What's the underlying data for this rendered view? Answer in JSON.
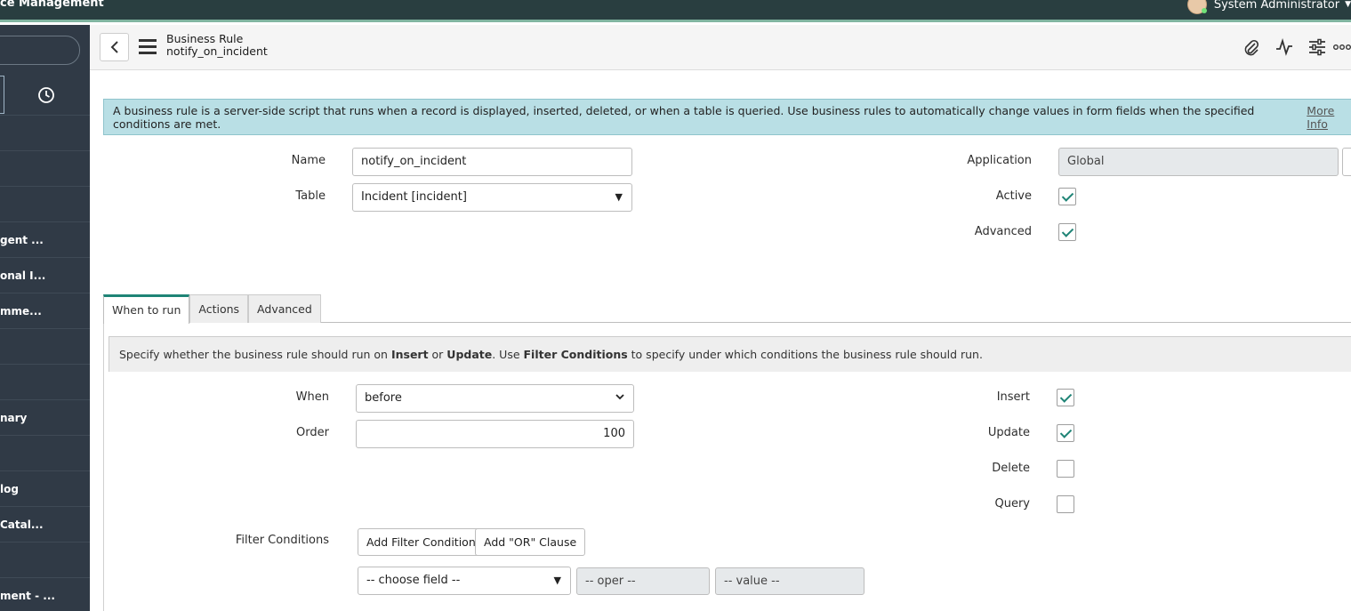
{
  "banner": {
    "brand": "ce Management",
    "user_name": "System Administrator"
  },
  "nav": {
    "items": [
      "",
      "",
      "",
      "gent ...",
      "onal I...",
      "mme...",
      "",
      "",
      "nary",
      "",
      "log",
      "Catal...",
      "",
      "ment - ..."
    ]
  },
  "header": {
    "record_type": "Business Rule",
    "record_name": "notify_on_incident"
  },
  "info_banner": {
    "text": "A business rule is a server-side script that runs when a record is displayed, inserted, deleted, or when a table is queried. Use business rules to automatically change values in form fields when the specified conditions are met.",
    "link": "More Info"
  },
  "form": {
    "name_label": "Name",
    "name_value": "notify_on_incident",
    "table_label": "Table",
    "table_value": "Incident [incident]",
    "application_label": "Application",
    "application_value": "Global",
    "active_label": "Active",
    "active_checked": true,
    "advanced_label": "Advanced",
    "advanced_checked": true
  },
  "tabs": [
    "When to run",
    "Actions",
    "Advanced"
  ],
  "when_to_run": {
    "info_p1": "Specify whether the business rule should run on ",
    "info_b1": "Insert",
    "info_p2": " or ",
    "info_b2": "Update",
    "info_p3": ". Use ",
    "info_b3": "Filter Conditions",
    "info_p4": " to specify under which conditions the business rule should run.",
    "when_label": "When",
    "when_value": "before",
    "order_label": "Order",
    "order_value": "100",
    "insert_label": "Insert",
    "insert_checked": true,
    "update_label": "Update",
    "update_checked": true,
    "delete_label": "Delete",
    "delete_checked": false,
    "query_label": "Query",
    "query_checked": false,
    "filter_label": "Filter Conditions",
    "add_filter_button": "Add Filter Condition",
    "add_or_button": "Add \"OR\" Clause",
    "choose_field": "-- choose field --",
    "oper": "-- oper --",
    "value": "-- value --"
  }
}
